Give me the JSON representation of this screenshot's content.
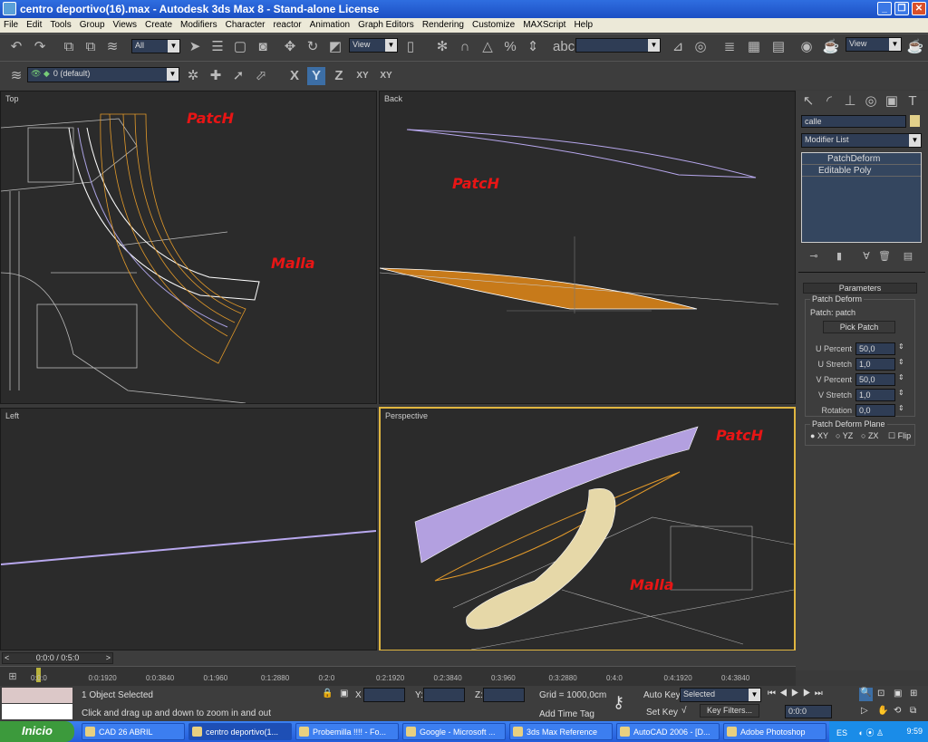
{
  "window": {
    "title": "centro deportivo(16).max - Autodesk 3ds Max 8  - Stand-alone License",
    "min": "_",
    "max": "❐",
    "close": "✕"
  },
  "menu": [
    "File",
    "Edit",
    "Tools",
    "Group",
    "Views",
    "Create",
    "Modifiers",
    "Character",
    "reactor",
    "Animation",
    "Graph Editors",
    "Rendering",
    "Customize",
    "MAXScript",
    "Help"
  ],
  "toolbar": {
    "selection_filter": "All",
    "ref_coord": "View",
    "named_sel": "",
    "view2": "View",
    "layer": "0 (default)",
    "axis": [
      "X",
      "Y",
      "Z",
      "XY",
      "XY"
    ],
    "active_axis": "Y"
  },
  "viewports": {
    "top": "Top",
    "back": "Back",
    "left": "Left",
    "perspective": "Perspective"
  },
  "annotations": {
    "top_patch": "PatcH",
    "top_malla": "Malla",
    "back_patch": "PatcH",
    "persp_patch": "PatcH",
    "persp_malla": "Malla"
  },
  "command_panel": {
    "object_name": "calle",
    "object_color": "#e2d08a",
    "modifier_list": "Modifier List",
    "stack": [
      "PatchDeform",
      "Editable Poly"
    ],
    "rollout": "Parameters",
    "group1": "Patch Deform",
    "patch": "Patch: patch",
    "pick_patch": "Pick Patch",
    "params": [
      {
        "label": "U Percent",
        "value": "50,0"
      },
      {
        "label": "U Stretch",
        "value": "1,0"
      },
      {
        "label": "V Percent",
        "value": "50,0"
      },
      {
        "label": "V Stretch",
        "value": "1,0"
      },
      {
        "label": "Rotation",
        "value": "0,0"
      }
    ],
    "group2": "Patch Deform Plane",
    "plane": [
      "XY",
      "YZ",
      "ZX"
    ],
    "plane_selected": "XY",
    "flip": "Flip"
  },
  "timeline": {
    "frame": "0:0:0 / 0:5:0",
    "prev": "<",
    "next": ">",
    "ticks": [
      "0:0:0",
      "0:0:1920",
      "0:0:3840",
      "0:1:960",
      "0:1:2880",
      "0:2:0",
      "0:2:1920",
      "0:2:3840",
      "0:3:960",
      "0:3:2880",
      "0:4:0",
      "0:4:1920",
      "0:4:3840"
    ]
  },
  "status": {
    "selected": "1 Object Selected",
    "prompt": "Click and drag up and down to zoom in and out",
    "x": "X",
    "y": "Y:",
    "z": "Z:",
    "grid": "Grid = 1000,0cm",
    "add_time_tag": "Add Time Tag",
    "auto_key": "Auto Key",
    "set_key": "Set Key",
    "key_mode": "Selected",
    "key_filters": "Key Filters...",
    "current_time": "0:0:0"
  },
  "taskbar": {
    "start": "Inicio",
    "items": [
      "CAD 26 ABRIL",
      "centro deportivo(1...",
      "Probemilla !!!! - Fo...",
      "Google - Microsoft ...",
      "3ds Max Reference",
      "AutoCAD 2006 - [D...",
      "Adobe Photoshop"
    ],
    "active": 1,
    "lang": "ES",
    "clock": "9:59"
  }
}
